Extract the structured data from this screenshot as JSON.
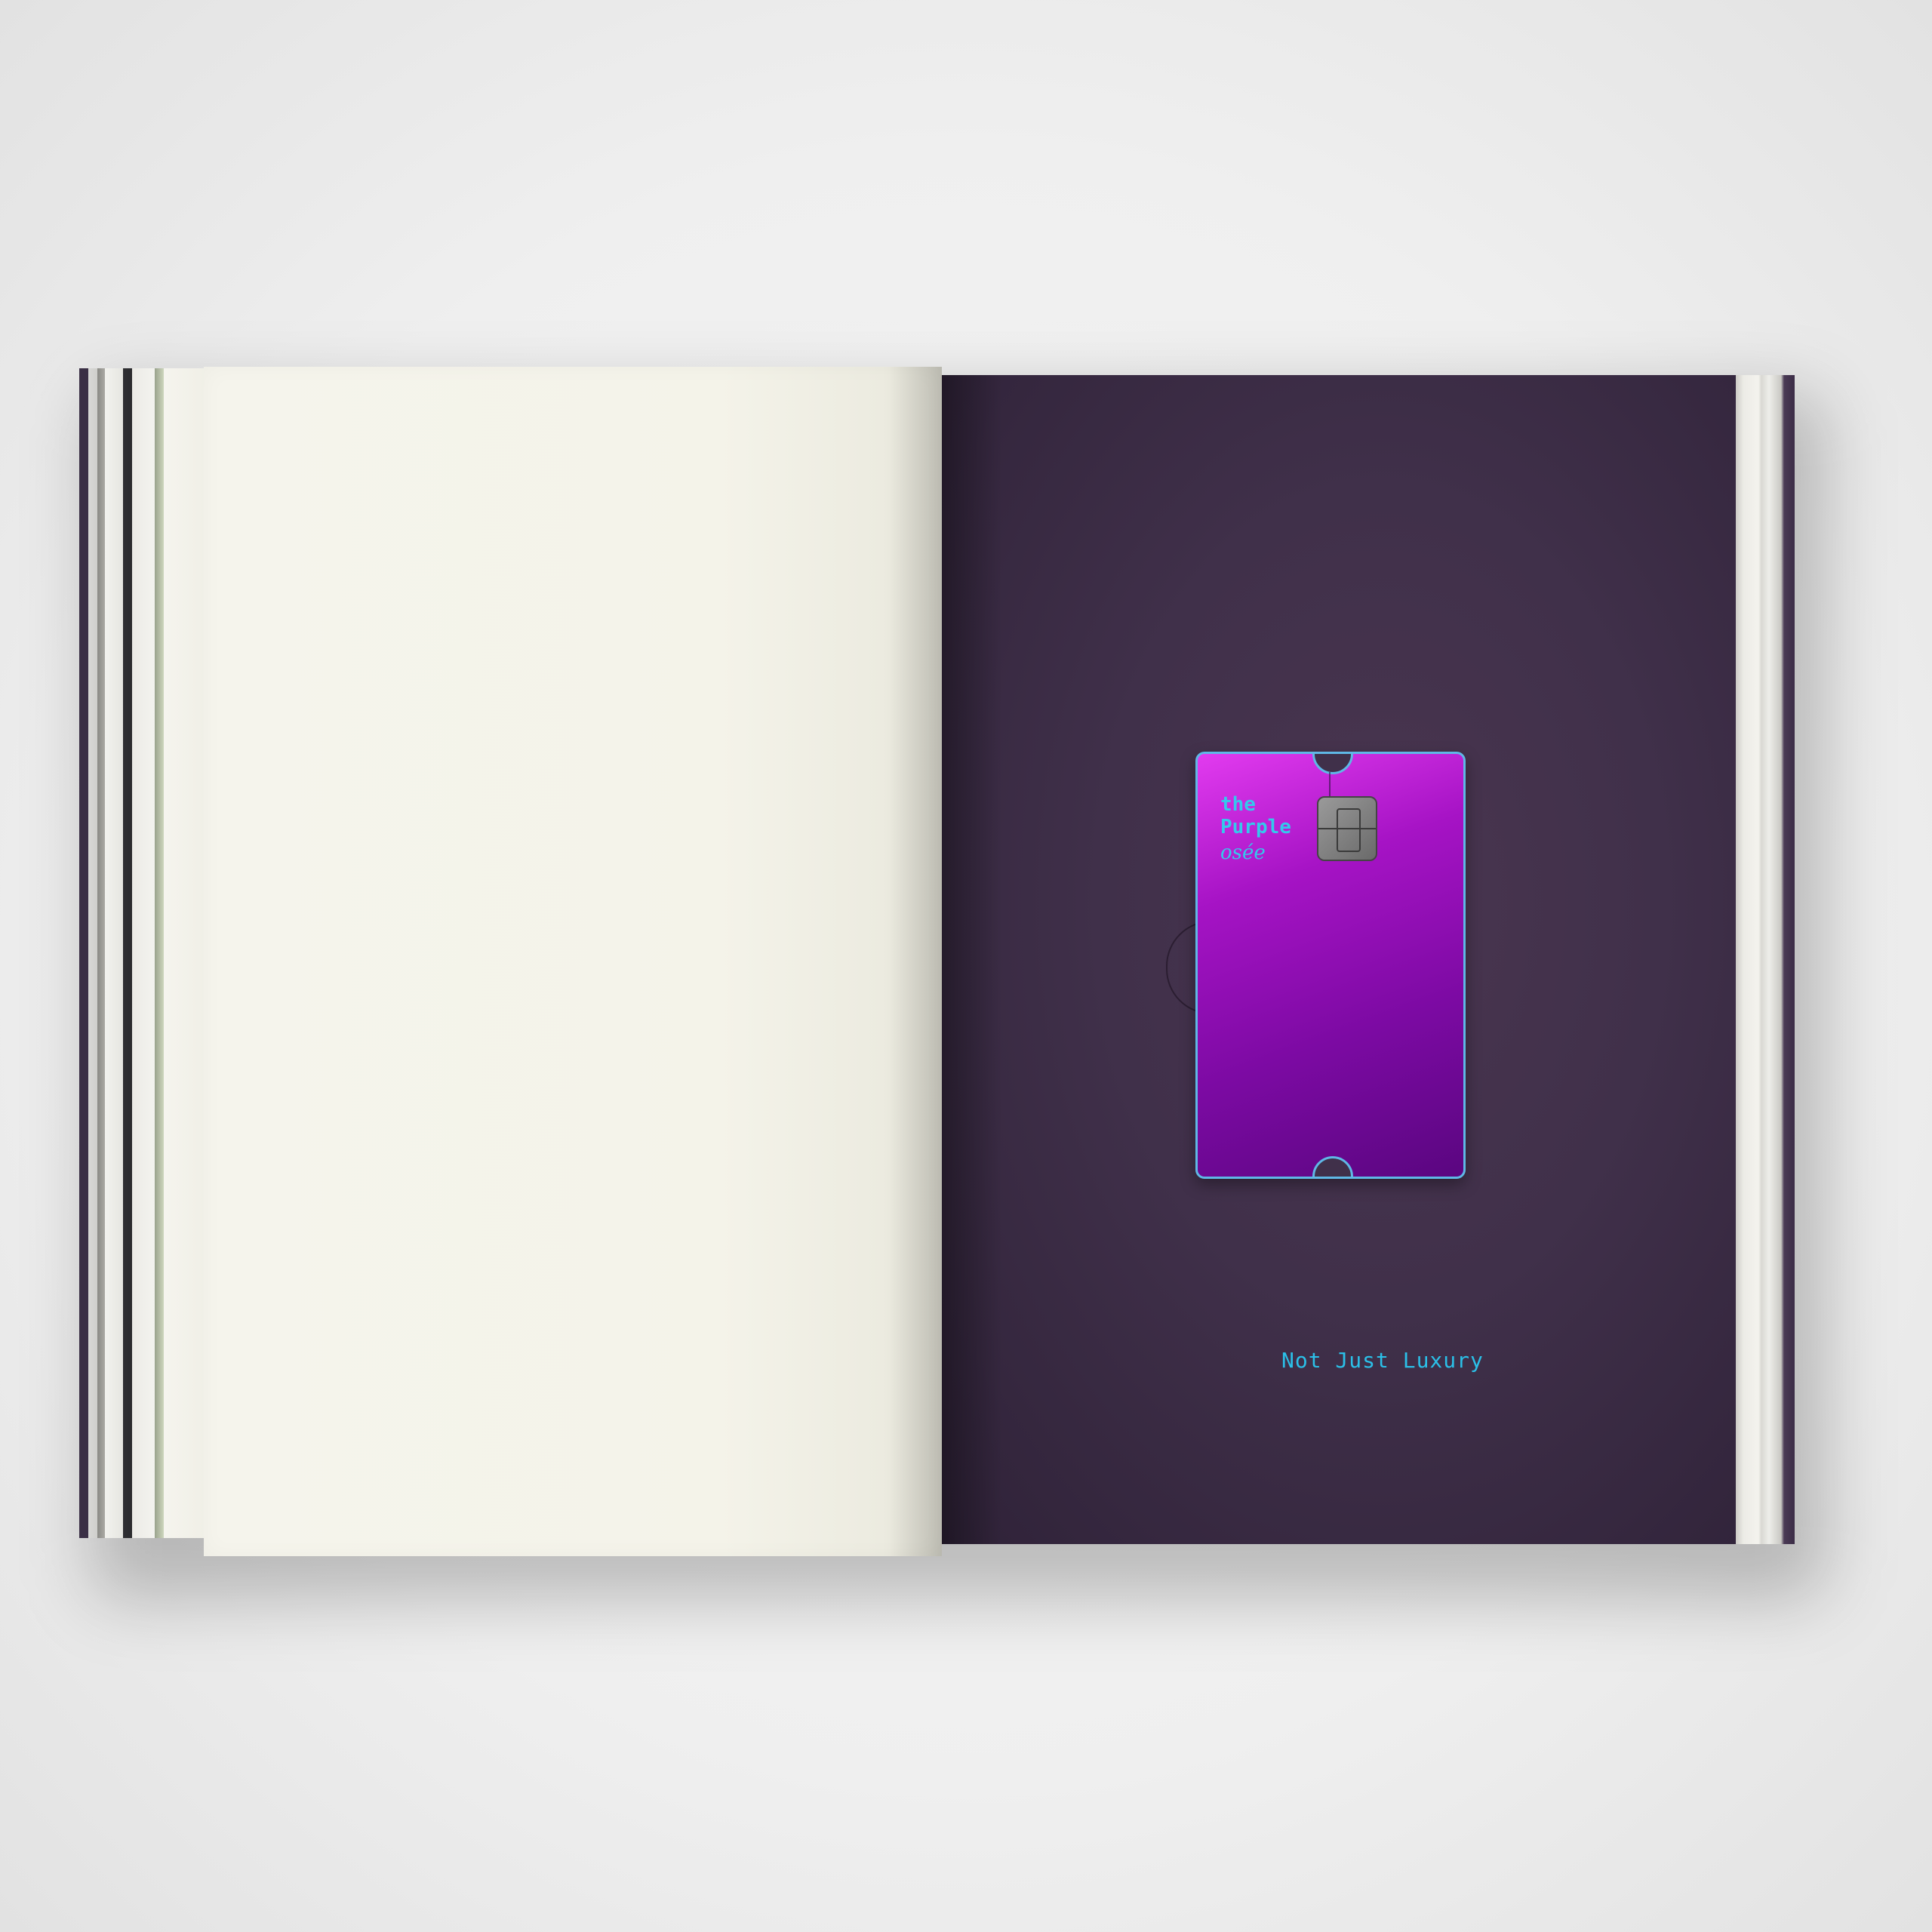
{
  "card": {
    "line1": "the",
    "line2": "Purple",
    "script": "osée"
  },
  "page": {
    "tagline": "Not Just Luxury"
  },
  "colors": {
    "page_purple": "#40304a",
    "card_magenta": "#e23bef",
    "card_purple": "#5a0680",
    "accent_cyan": "#2bc0e8",
    "paper": "#f4f3e9"
  }
}
